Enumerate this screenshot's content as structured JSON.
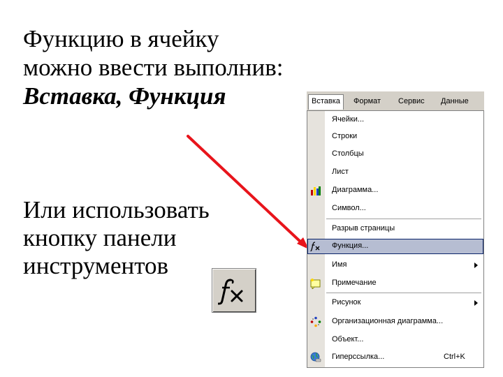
{
  "text": {
    "line1": "Функцию в ячейку",
    "line2": "можно ввести выполнив:",
    "line3_bold": "Вставка, Функция",
    "line4": "Или использовать",
    "line5": "кнопку панели",
    "line6": "инструментов"
  },
  "toolbar_button": {
    "icon": "function-fx-icon",
    "glyph": "fx"
  },
  "menubar": [
    "Вставка",
    "Формат",
    "Сервис",
    "Данные"
  ],
  "menu_items": [
    {
      "label": "Ячейки...",
      "icon": null
    },
    {
      "label": "Строки",
      "icon": null
    },
    {
      "label": "Столбцы",
      "icon": null
    },
    {
      "label": "Лист",
      "icon": null
    },
    {
      "label": "Диаграмма...",
      "icon": "chart-icon"
    },
    {
      "label": "Символ...",
      "icon": null
    },
    {
      "label": "Разрыв страницы",
      "icon": null
    },
    {
      "label": "Функция...",
      "icon": "function-icon",
      "highlighted": true
    },
    {
      "label": "Имя",
      "icon": null,
      "submenu": true
    },
    {
      "label": "Примечание",
      "icon": "note-icon"
    },
    {
      "label": "Рисунок",
      "icon": null,
      "submenu": true
    },
    {
      "label": "Организационная диаграмма...",
      "icon": "org-chart-icon"
    },
    {
      "label": "Объект...",
      "icon": null
    },
    {
      "label": "Гиперссылка...",
      "icon": "hyperlink-icon",
      "shortcut": "Ctrl+K"
    }
  ],
  "colors": {
    "arrow": "#e8141b",
    "menu_bg": "#d4d0c8",
    "highlight": "#b6bdd2",
    "highlight_border": "#0a246a"
  }
}
